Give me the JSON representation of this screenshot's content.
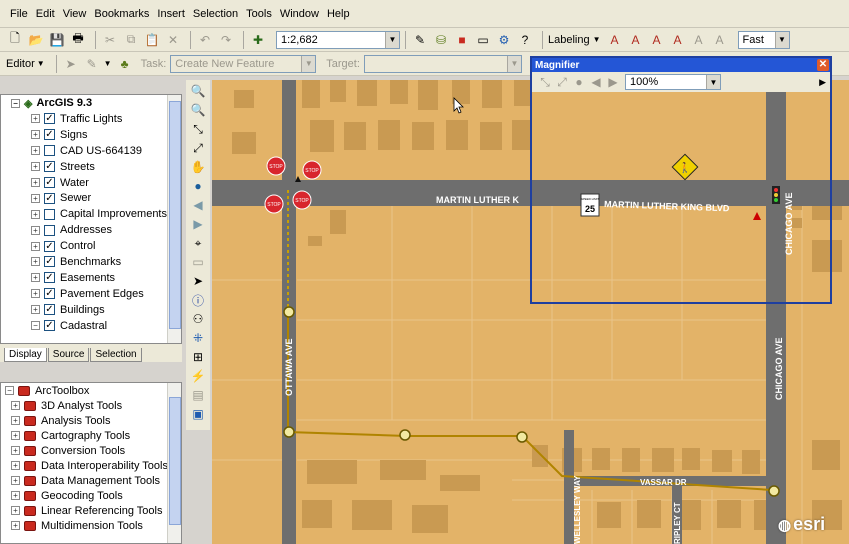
{
  "menu": [
    "File",
    "Edit",
    "View",
    "Bookmarks",
    "Insert",
    "Selection",
    "Tools",
    "Window",
    "Help"
  ],
  "standard_toolbar": {
    "scale": "1:2,682",
    "labeling_label": "Labeling",
    "quality": "Fast"
  },
  "editor_toolbar": {
    "editor_label": "Editor",
    "task_label": "Task:",
    "task_value": "Create New Feature",
    "target_label": "Target:"
  },
  "toc": {
    "root": "ArcGIS 9.3",
    "layers": [
      {
        "name": "Traffic Lights",
        "checked": true
      },
      {
        "name": "Signs",
        "checked": true
      },
      {
        "name": "CAD US-664139",
        "checked": false
      },
      {
        "name": "Streets",
        "checked": true
      },
      {
        "name": "Water",
        "checked": true
      },
      {
        "name": "Sewer",
        "checked": true
      },
      {
        "name": "Capital Improvements",
        "checked": false
      },
      {
        "name": "Addresses",
        "checked": false
      },
      {
        "name": "Control",
        "checked": true
      },
      {
        "name": "Benchmarks",
        "checked": true
      },
      {
        "name": "Easements",
        "checked": true
      },
      {
        "name": "Pavement Edges",
        "checked": true
      },
      {
        "name": "Buildings",
        "checked": true
      },
      {
        "name": "Cadastral",
        "checked": true
      }
    ],
    "tabs": [
      "Display",
      "Source",
      "Selection"
    ]
  },
  "arctoolbox": {
    "root": "ArcToolbox",
    "items": [
      "3D Analyst Tools",
      "Analysis Tools",
      "Cartography Tools",
      "Conversion Tools",
      "Data Interoperability Tools",
      "Data Management Tools",
      "Geocoding Tools",
      "Linear Referencing Tools",
      "Multidimension Tools"
    ]
  },
  "map": {
    "streets": {
      "mlk": "MARTIN LUTHER KING BLVD",
      "mlk_clipped": "MARTIN LUTHER K",
      "chicago": "CHICAGO AVE",
      "ottawa": "OTTAWA AVE",
      "vassar": "VASSAR DR",
      "wellesley": "WELLESLEY WAY",
      "ripley": "RIPLEY CT"
    },
    "stop_sign": "STOP",
    "speed_limit": {
      "header": "SPEED LIMIT",
      "value": "25"
    },
    "colors": {
      "parcel": "#e3b368",
      "building": "#c99a52",
      "road": "#6e6e6e",
      "easement": "#b08400"
    }
  },
  "magnifier": {
    "title": "Magnifier",
    "zoom": "100%"
  },
  "watermark": "esri"
}
